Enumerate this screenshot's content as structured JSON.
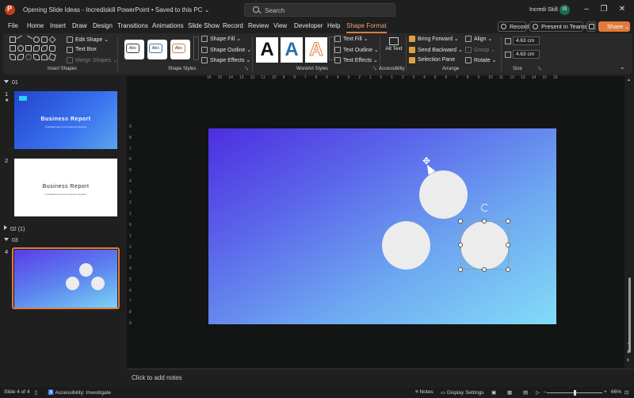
{
  "app": {
    "title": "Opening Slide Ideas - Incrediskill PowerPoint • Saved to this PC ⌄",
    "search_placeholder": "Search",
    "user_name": "Incredi Skill",
    "user_initials": "IS"
  },
  "menu": {
    "tabs": [
      "File",
      "Home",
      "Insert",
      "Draw",
      "Design",
      "Transitions",
      "Animations",
      "Slide Show",
      "Record",
      "Review",
      "View",
      "Developer",
      "Help",
      "Shape Format"
    ],
    "active_tab": "Shape Format",
    "record_label": "Record",
    "teams_label": "Present in Teams",
    "share_label": "Share ⌄"
  },
  "ribbon": {
    "insert_shapes": {
      "edit_shape": "Edit Shape ⌄",
      "text_box": "Text Box",
      "merge_shapes": "Merge Shapes ⌄",
      "label": "Insert Shapes"
    },
    "shape_styles": {
      "sample_text": "Abc",
      "fill": "Shape Fill ⌄",
      "outline": "Shape Outline ⌄",
      "effects": "Shape Effects ⌄",
      "label": "Shape Styles"
    },
    "wordart": {
      "letter": "A",
      "text_fill": "Text Fill ⌄",
      "text_outline": "Text Outline ⌄",
      "text_effects": "Text Effects ⌄",
      "label": "WordArt Styles"
    },
    "accessibility": {
      "alt_text": "Alt Text",
      "label": "Accessibility"
    },
    "arrange": {
      "bring_forward": "Bring Forward ⌄",
      "send_backward": "Send Backward ⌄",
      "selection_pane": "Selection Pane",
      "align": "Align ⌄",
      "group": "Group ⌄",
      "rotate": "Rotate ⌄",
      "label": "Arrange"
    },
    "size": {
      "height": "4.63 cm",
      "width": "4.63 cm",
      "label": "Size"
    }
  },
  "sidebar": {
    "sections": [
      "01",
      "02 (1)",
      "03"
    ],
    "slides": [
      {
        "number": "1",
        "title": "Business Report",
        "subtitle": "A detailed look at our business situation"
      },
      {
        "number": "2",
        "title": "Business Report",
        "subtitle": "A detailed look at our business situation"
      },
      {
        "number": "4"
      }
    ]
  },
  "ruler": {
    "horizontal": [
      "16",
      "15",
      "14",
      "13",
      "12",
      "11",
      "10",
      "9",
      "8",
      "7",
      "6",
      "5",
      "4",
      "3",
      "2",
      "1",
      "0",
      "1",
      "2",
      "3",
      "4",
      "5",
      "6",
      "7",
      "8",
      "9",
      "10",
      "11",
      "12",
      "13",
      "14",
      "15",
      "16"
    ],
    "vertical": [
      "9",
      "8",
      "7",
      "6",
      "5",
      "4",
      "3",
      "2",
      "1",
      "0",
      "1",
      "2",
      "3",
      "4",
      "5",
      "6",
      "7",
      "8",
      "9"
    ]
  },
  "notes": {
    "placeholder": "Click to add notes"
  },
  "status": {
    "slide": "Slide 4 of 4",
    "accessibility": "Accessibility: Investigate",
    "notes": "Notes",
    "display": "Display Settings",
    "zoom": "66%"
  },
  "colors": {
    "accent": "#e07a3c",
    "slide_gradient": [
      "#4d2ee0",
      "#82dcf7"
    ],
    "circle_fill": "#ececec"
  }
}
